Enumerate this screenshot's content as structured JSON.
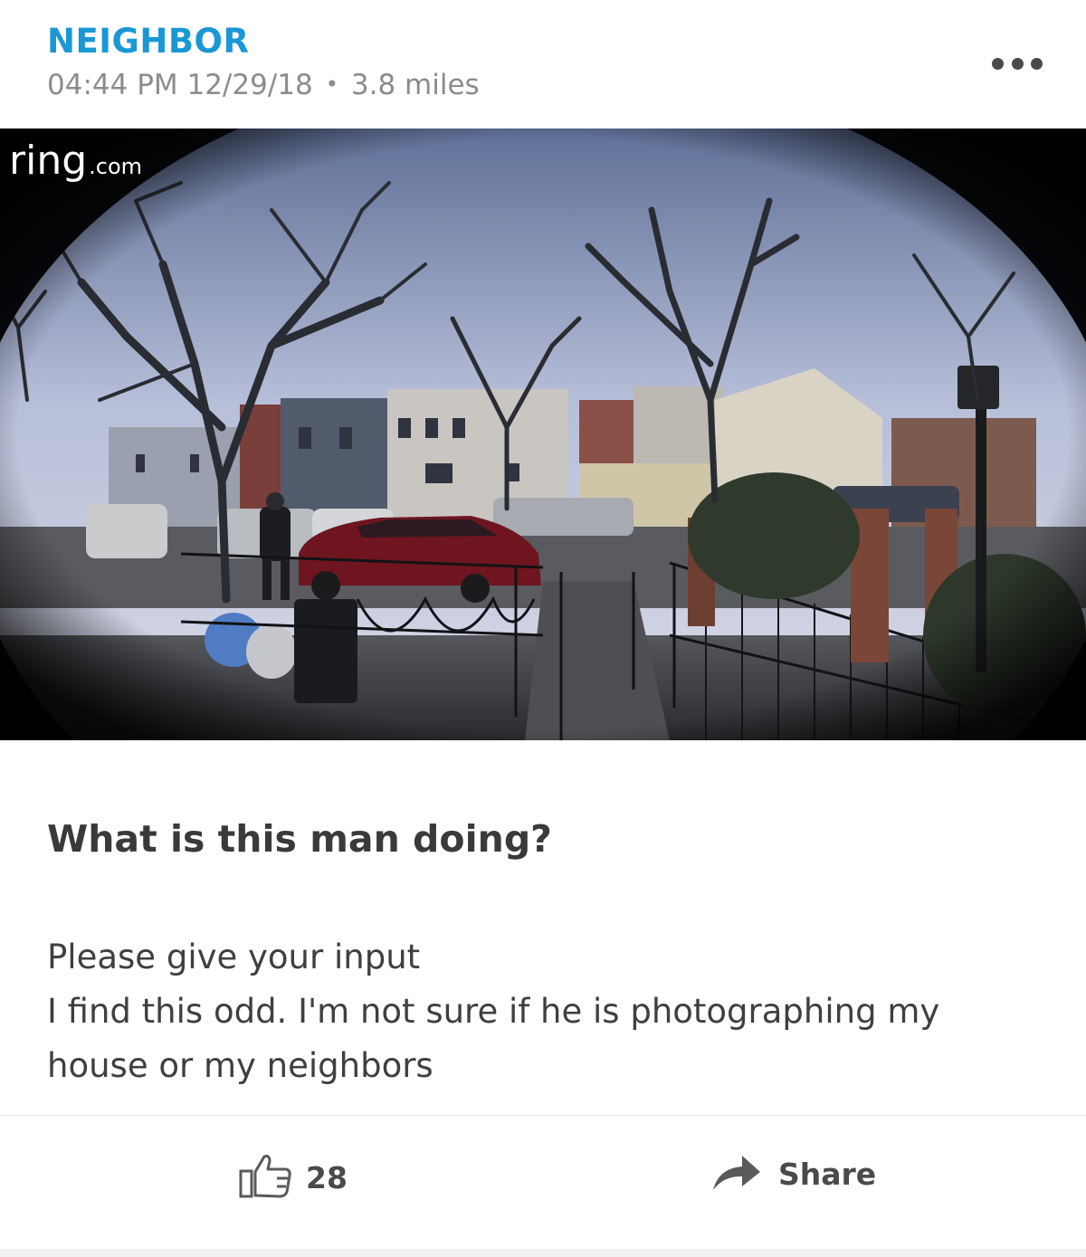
{
  "post": {
    "category": "NEIGHBOR",
    "time": "04:44 PM 12/29/18",
    "separator": "•",
    "distance": "3.8 miles",
    "title": "What is this man doing?",
    "body_lines": [
      "Please give your input",
      "I find this odd. I'm not sure if he is photographing my",
      "house or my neighbors"
    ]
  },
  "video": {
    "watermark_brand": "ring",
    "watermark_suffix": ".com"
  },
  "actions": {
    "like_count": "28",
    "share_label": "Share"
  },
  "icons": {
    "more": "more-dots-icon",
    "like": "thumbs-up-icon",
    "share": "share-arrow-icon"
  },
  "colors": {
    "accent": "#1a98d5",
    "meta_text": "#8c8c8c",
    "body_text": "#3f3f3f"
  }
}
